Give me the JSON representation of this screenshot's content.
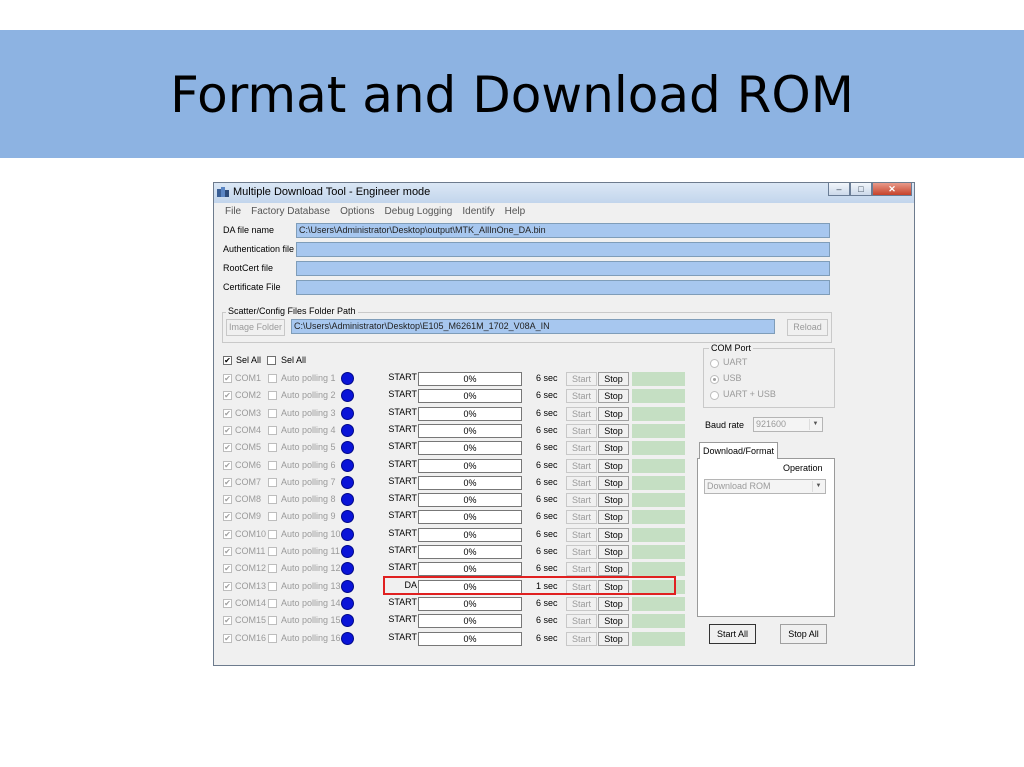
{
  "slide": {
    "title": "Format and Download ROM"
  },
  "window": {
    "title": "Multiple Download Tool - Engineer mode",
    "minimize_glyph": "‒",
    "maximize_glyph": "□",
    "close_glyph": "✕"
  },
  "menu": [
    "File",
    "Factory Database",
    "Options",
    "Debug Logging",
    "Identify",
    "Help"
  ],
  "files": {
    "da_label": "DA file name",
    "da_value": "C:\\Users\\Administrator\\Desktop\\output\\MTK_AllInOne_DA.bin",
    "auth_label": "Authentication file",
    "auth_value": "",
    "rootcert_label": "RootCert file",
    "rootcert_value": "",
    "cert_label": "Certificate File",
    "cert_value": ""
  },
  "scatter": {
    "group_title": "Scatter/Config Files Folder Path",
    "image_folder_button": "Image Folder",
    "path": "C:\\Users\\Administrator\\Desktop\\E105_M6261M_1702_V08A_IN",
    "reload_button": "Reload"
  },
  "selection": {
    "sel_all_1": "Sel All",
    "sel_all_1_checked": true,
    "sel_all_2": "Sel All",
    "sel_all_2_checked": false
  },
  "ports": [
    {
      "com": "COM1",
      "polling": "Auto polling 1",
      "status": "START",
      "progress": "0%",
      "time": "6 sec",
      "start": "Start",
      "stop": "Stop"
    },
    {
      "com": "COM2",
      "polling": "Auto polling 2",
      "status": "START",
      "progress": "0%",
      "time": "6 sec",
      "start": "Start",
      "stop": "Stop"
    },
    {
      "com": "COM3",
      "polling": "Auto polling 3",
      "status": "START",
      "progress": "0%",
      "time": "6 sec",
      "start": "Start",
      "stop": "Stop"
    },
    {
      "com": "COM4",
      "polling": "Auto polling 4",
      "status": "START",
      "progress": "0%",
      "time": "6 sec",
      "start": "Start",
      "stop": "Stop"
    },
    {
      "com": "COM5",
      "polling": "Auto polling 5",
      "status": "START",
      "progress": "0%",
      "time": "6 sec",
      "start": "Start",
      "stop": "Stop"
    },
    {
      "com": "COM6",
      "polling": "Auto polling 6",
      "status": "START",
      "progress": "0%",
      "time": "6 sec",
      "start": "Start",
      "stop": "Stop"
    },
    {
      "com": "COM7",
      "polling": "Auto polling 7",
      "status": "START",
      "progress": "0%",
      "time": "6 sec",
      "start": "Start",
      "stop": "Stop"
    },
    {
      "com": "COM8",
      "polling": "Auto polling 8",
      "status": "START",
      "progress": "0%",
      "time": "6 sec",
      "start": "Start",
      "stop": "Stop"
    },
    {
      "com": "COM9",
      "polling": "Auto polling 9",
      "status": "START",
      "progress": "0%",
      "time": "6 sec",
      "start": "Start",
      "stop": "Stop"
    },
    {
      "com": "COM10",
      "polling": "Auto polling 10",
      "status": "START",
      "progress": "0%",
      "time": "6 sec",
      "start": "Start",
      "stop": "Stop"
    },
    {
      "com": "COM11",
      "polling": "Auto polling 11",
      "status": "START",
      "progress": "0%",
      "time": "6 sec",
      "start": "Start",
      "stop": "Stop"
    },
    {
      "com": "COM12",
      "polling": "Auto polling 12",
      "status": "START",
      "progress": "0%",
      "time": "6 sec",
      "start": "Start",
      "stop": "Stop"
    },
    {
      "com": "COM13",
      "polling": "Auto polling 13",
      "status": "DA",
      "progress": "0%",
      "time": "1 sec",
      "start": "Start",
      "stop": "Stop"
    },
    {
      "com": "COM14",
      "polling": "Auto polling 14",
      "status": "START",
      "progress": "0%",
      "time": "6 sec",
      "start": "Start",
      "stop": "Stop"
    },
    {
      "com": "COM15",
      "polling": "Auto polling 15",
      "status": "START",
      "progress": "0%",
      "time": "6 sec",
      "start": "Start",
      "stop": "Stop"
    },
    {
      "com": "COM16",
      "polling": "Auto polling 16",
      "status": "START",
      "progress": "0%",
      "time": "6 sec",
      "start": "Start",
      "stop": "Stop"
    }
  ],
  "com_port": {
    "group_title": "COM Port",
    "options": [
      "UART",
      "USB",
      "UART + USB"
    ],
    "selected": "USB"
  },
  "baud": {
    "label": "Baud rate",
    "value": "921600"
  },
  "download": {
    "tab": "Download/Format",
    "operation_label": "Operation",
    "operation_value": "Download ROM"
  },
  "actions": {
    "start_all": "Start All",
    "stop_all": "Stop All"
  },
  "colors": {
    "banner": "#8db3e2",
    "field": "#a7c7ef",
    "led": "#0a14d8",
    "result": "#c5dfc3",
    "highlight": "#e02020"
  }
}
